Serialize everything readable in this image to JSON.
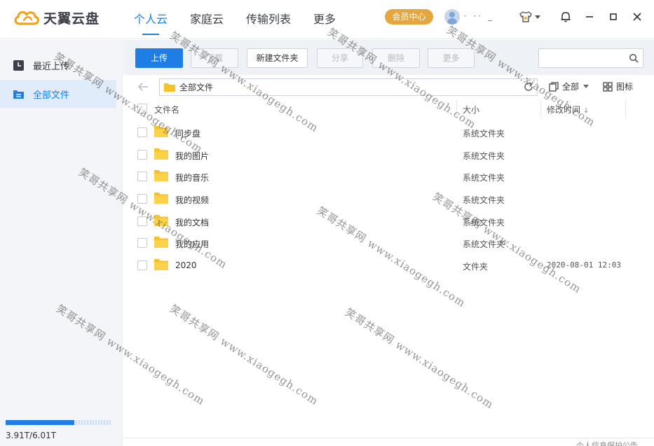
{
  "app": {
    "logo_text": "天翼云盘",
    "nav": [
      {
        "label": "个人云",
        "active": true
      },
      {
        "label": "家庭云",
        "active": false
      },
      {
        "label": "传输列表",
        "active": false
      },
      {
        "label": "更多",
        "active": false
      }
    ],
    "vip_label": "会员中心",
    "username": "· ·· _",
    "accent_color": "#1e7ee6",
    "vip_color": "#e5a73d"
  },
  "sidebar": {
    "items": [
      {
        "label": "最近上传",
        "icon": "recent-upload-icon",
        "active": false
      },
      {
        "label": "全部文件",
        "icon": "all-files-icon",
        "active": true
      }
    ],
    "storage": {
      "text": "3.91T/6.01T",
      "used_fraction": 0.65
    }
  },
  "toolbar": {
    "upload": "上传",
    "download": "下载",
    "new_folder": "新建文件夹",
    "share": "分享",
    "delete": "删除",
    "more": "更多",
    "search_placeholder": ""
  },
  "path": {
    "current": "全部文件",
    "filter_label": "全部",
    "view_label": "图标"
  },
  "table": {
    "columns": {
      "name": "文件名",
      "size": "大小",
      "mtime": "修改时间"
    },
    "sort_indicator": "↓",
    "rows": [
      {
        "name": "同步盘",
        "type": "系统文件夹",
        "mtime": ""
      },
      {
        "name": "我的图片",
        "type": "系统文件夹",
        "mtime": ""
      },
      {
        "name": "我的音乐",
        "type": "系统文件夹",
        "mtime": ""
      },
      {
        "name": "我的视频",
        "type": "系统文件夹",
        "mtime": ""
      },
      {
        "name": "我的文档",
        "type": "系统文件夹",
        "mtime": ""
      },
      {
        "name": "我的应用",
        "type": "系统文件夹",
        "mtime": ""
      },
      {
        "name": "2020",
        "type": "文件夹",
        "mtime": "2020-08-01 12:03"
      }
    ]
  },
  "footer": {
    "link": "个人信息保护公告"
  },
  "watermark": "笑哥共享网 www.xiaogegh.com"
}
